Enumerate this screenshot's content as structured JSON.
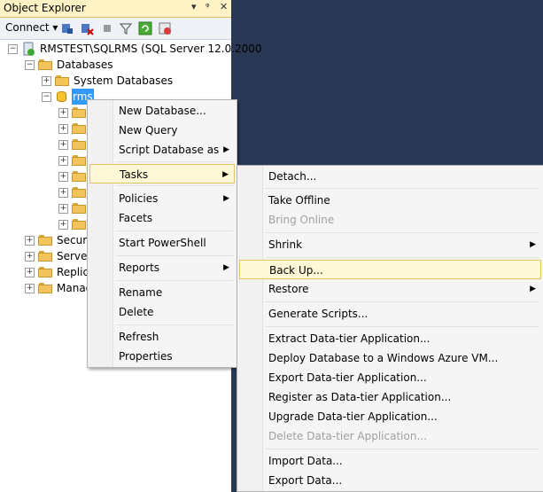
{
  "panel": {
    "title": "Object Explorer",
    "title_buttons": [
      "▾",
      "ᵠ",
      "✕"
    ],
    "toolbar": {
      "connect_label": "Connect ▾"
    }
  },
  "tree": {
    "server": "RMSTEST\\SQLRMS (SQL Server 12.0.2000",
    "databases": "Databases",
    "system_databases": "System Databases",
    "selected_db": "rms",
    "security": "Securit",
    "server_objects": "Server",
    "replication": "Replic",
    "management": "Manag"
  },
  "context_menu": {
    "items": [
      "New Database...",
      "New Query",
      "Script Database as",
      "Tasks",
      "Policies",
      "Facets",
      "Start PowerShell",
      "Reports",
      "Rename",
      "Delete",
      "Refresh",
      "Properties"
    ]
  },
  "tasks_menu": {
    "items": [
      "Detach...",
      "Take Offline",
      "Bring Online",
      "Shrink",
      "Back Up...",
      "Restore",
      "Generate Scripts...",
      "Extract Data-tier Application...",
      "Deploy Database to a Windows Azure VM...",
      "Export Data-tier Application...",
      "Register as Data-tier Application...",
      "Upgrade Data-tier Application...",
      "Delete Data-tier Application...",
      "Import Data...",
      "Export Data..."
    ]
  },
  "colors": {
    "background": "#293955",
    "highlight": "#fff8d6",
    "selection": "#3399ff"
  }
}
